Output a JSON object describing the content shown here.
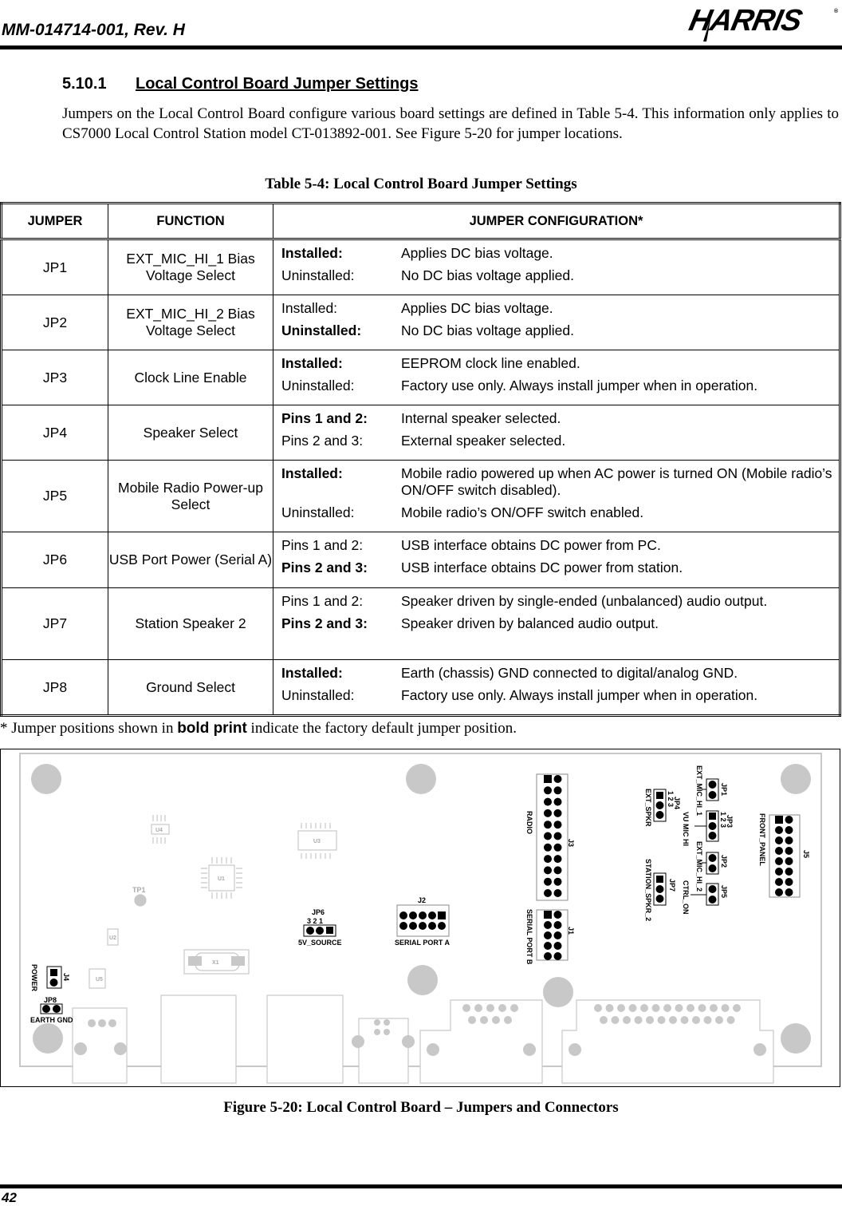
{
  "header": {
    "doc_id": "MM-014714-001, Rev. H",
    "logo_text": "HARRIS"
  },
  "section": {
    "number": "5.10.1",
    "title": "Local Control Board Jumper Settings"
  },
  "intro": "Jumpers on the Local Control Board configure various board settings are defined in Table 5-4. This information only applies to CS7000 Local Control Station model CT-013892-001.  See Figure 5-20 for jumper locations.",
  "table": {
    "caption": "Table 5-4: Local Control Board Jumper Settings",
    "headers": [
      "JUMPER",
      "FUNCTION",
      "JUMPER CONFIGURATION*"
    ],
    "rows": [
      {
        "jumper": "JP1",
        "function": "EXT_MIC_HI_1 Bias Voltage Select",
        "configs": [
          {
            "state": "Installed:",
            "desc": "Applies DC bias voltage.",
            "bold": true
          },
          {
            "state": "Uninstalled:",
            "desc": "No DC bias voltage applied.",
            "bold": false
          }
        ]
      },
      {
        "jumper": "JP2",
        "function": "EXT_MIC_HI_2 Bias Voltage Select",
        "configs": [
          {
            "state": "Installed:",
            "desc": "Applies DC bias voltage.",
            "bold": false
          },
          {
            "state": "Uninstalled:",
            "desc": "No DC bias voltage applied.",
            "bold": true
          }
        ]
      },
      {
        "jumper": "JP3",
        "function": "Clock Line Enable",
        "configs": [
          {
            "state": "Installed:",
            "desc": "EEPROM clock line enabled.",
            "bold": true
          },
          {
            "state": "Uninstalled:",
            "desc": "Factory use only. Always install jumper when in operation.",
            "bold": false
          }
        ]
      },
      {
        "jumper": "JP4",
        "function": "Speaker Select",
        "configs": [
          {
            "state": "Pins 1 and 2:",
            "desc": "Internal speaker selected.",
            "bold": true
          },
          {
            "state": "Pins 2 and 3:",
            "desc": "External speaker selected.",
            "bold": false
          }
        ]
      },
      {
        "jumper": "JP5",
        "function": "Mobile Radio Power-up Select",
        "configs": [
          {
            "state": "Installed:",
            "desc": "Mobile radio powered up when AC power is turned ON (Mobile radio’s ON/OFF switch disabled).",
            "bold": true
          },
          {
            "state": "Uninstalled:",
            "desc": "Mobile radio’s ON/OFF switch enabled.",
            "bold": false
          }
        ]
      },
      {
        "jumper": "JP6",
        "function": "USB Port Power (Serial A)",
        "configs": [
          {
            "state": "Pins 1 and 2:",
            "desc": "USB interface obtains DC power from PC.",
            "bold": false
          },
          {
            "state": "Pins 2 and 3:",
            "desc": "USB interface obtains DC power from station.",
            "bold": true
          }
        ]
      },
      {
        "jumper": "JP7",
        "function": "Station Speaker 2",
        "configs": [
          {
            "state": "Pins 1 and 2:",
            "desc": "Speaker driven by single-ended (unbalanced) audio output.",
            "bold": false
          },
          {
            "state": "Pins 2 and 3:",
            "desc": "Speaker driven by balanced audio output.",
            "bold": true
          }
        ]
      },
      {
        "jumper": "JP8",
        "function": "Ground Select",
        "configs": [
          {
            "state": "Installed:",
            "desc": "Earth (chassis) GND connected to digital/analog GND.",
            "bold": true
          },
          {
            "state": "Uninstalled:",
            "desc": "Factory use only. Always install jumper when in operation.",
            "bold": false
          }
        ]
      }
    ]
  },
  "footnote": {
    "prefix": "* Jumper positions shown in ",
    "bold": "bold print",
    "suffix": " indicate the factory default jumper position."
  },
  "figure": {
    "caption": "Figure 5-20:  Local Control Board – Jumpers and Connectors",
    "labels": {
      "j3": "J3",
      "radio": "RADIO",
      "j1": "J1",
      "serial_port_b": "SERIAL PORT B",
      "jp1": "JP1",
      "jp2": "JP2",
      "jp3": "JP3",
      "jp4": "JP4",
      "jp5": "JP5",
      "jp6": "JP6",
      "jp7": "JP7",
      "jp8": "JP8",
      "pins_123": "1  2  3",
      "pins_321": "3   2   1",
      "ext_mic_hi_1": "EXT_MIC_HI_1",
      "ext_mic_hi_2": "EXT_MIC_HI_2",
      "vu_mic_hi": "VU MIC HI",
      "ctrl_on": "CTRL_ON",
      "ext_spkr": "EXT_SPKR",
      "station_spkr_2": "STATION_SPKR_2",
      "j5": "J5",
      "front_panel": "FRONT_PANEL",
      "j2": "J2",
      "serial_port_a": "SERIAL PORT A",
      "v5_source": "5V_SOURCE",
      "j4": "J4",
      "power": "POWER",
      "earth_gnd": "EARTH GND",
      "tp1": "TP1",
      "u1": "U1",
      "u2": "U2",
      "u3": "U3",
      "u4": "U4",
      "u5": "U5",
      "x1": "X1"
    }
  },
  "footer": {
    "page_number": "42"
  }
}
